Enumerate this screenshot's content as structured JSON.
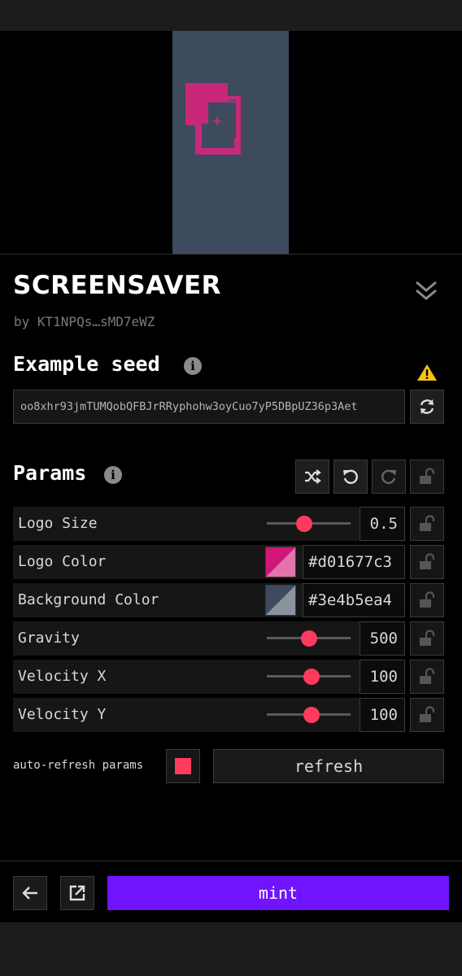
{
  "token": {
    "title": "SCREENSAVER",
    "author": "by KT1NPQs…sMD7eWZ"
  },
  "seed": {
    "heading": "Example seed",
    "value": "oo8xhr93jmTUMQobQFBJrRRyphohw3oyCuo7yP5DBpUZ36p3Aet"
  },
  "params": {
    "heading": "Params",
    "items": [
      {
        "label": "Logo Size",
        "type": "slider",
        "value": "0.5",
        "fraction": 0.45
      },
      {
        "label": "Logo Color",
        "type": "color",
        "value": "#d01677c3",
        "swatch": "#d01677"
      },
      {
        "label": "Background Color",
        "type": "color",
        "value": "#3e4b5ea4",
        "swatch": "#3e4b5e"
      },
      {
        "label": "Gravity",
        "type": "slider",
        "value": "500",
        "fraction": 0.5
      },
      {
        "label": "Velocity X",
        "type": "slider",
        "value": "100",
        "fraction": 0.53
      },
      {
        "label": "Velocity Y",
        "type": "slider",
        "value": "100",
        "fraction": 0.53
      }
    ]
  },
  "auto_refresh": {
    "label": "auto-refresh params",
    "checked": true,
    "refresh_label": "refresh"
  },
  "footer": {
    "mint_label": "mint"
  },
  "colors": {
    "accent": "#ff3a5e",
    "mint": "#7014ff",
    "logo": "#d01677",
    "background": "#3e4b5e",
    "warning": "#f5c518"
  },
  "icons": [
    "info-icon",
    "warning-icon",
    "refresh-icon",
    "shuffle-icon",
    "undo-icon",
    "redo-icon",
    "lock-icon",
    "chevron-down-icon",
    "arrow-left-icon",
    "external-link-icon"
  ]
}
